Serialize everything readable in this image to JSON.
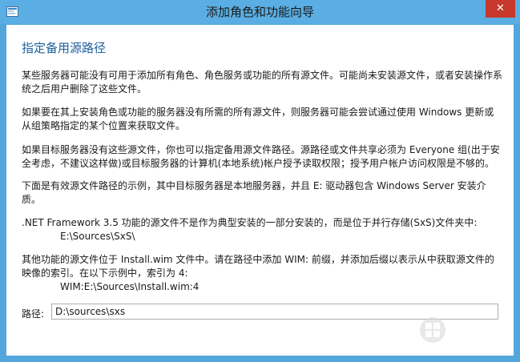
{
  "window": {
    "title": "添加角色和功能向导",
    "close_label": "✕"
  },
  "page": {
    "heading": "指定备用源路径",
    "paragraphs": [
      "某些服务器可能没有可用于添加所有角色、角色服务或功能的所有源文件。可能尚未安装源文件，或者安装操作系统之后用户删除了这些文件。",
      "如果要在其上安装角色或功能的服务器没有所需的所有源文件，则服务器可能会尝试通过使用 Windows 更新或从组策略指定的某个位置来获取文件。",
      "如果目标服务器没有这些源文件，你也可以指定备用源文件路径。源路径或文件共享必须为 Everyone 组(出于安全考虑，不建议这样做)或目标服务器的计算机(本地系统)帐户授予读取权限；授予用户帐户访问权限是不够的。",
      "下面是有效源文件路径的示例，其中目标服务器是本地服务器，并且 E: 驱动器包含 Windows Server 安装介质。"
    ],
    "netfx_text": ".NET Framework 3.5 功能的源文件不是作为典型安装的一部分安装的，而是位于并行存储(SxS)文件夹中:",
    "netfx_path": "E:\\Sources\\SxS\\",
    "wim_text": "其他功能的源文件位于 Install.wim 文件中。请在路径中添加 WIM: 前缀，并添加后缀以表示从中获取源文件的映像的索引。在以下示例中，索引为 4:",
    "wim_path": "WIM:E:\\Sources\\Install.wim:4",
    "path_label": "路径:",
    "path_value": "D:\\sources\\sxs"
  },
  "icons": {
    "app": "server-manager-icon",
    "close": "close-icon",
    "watermark": "windows-logo-icon"
  },
  "colors": {
    "titlebar": "#5aaee3",
    "frame": "#52a6dc",
    "close": "#c8392d",
    "heading": "#1c5f9a"
  }
}
